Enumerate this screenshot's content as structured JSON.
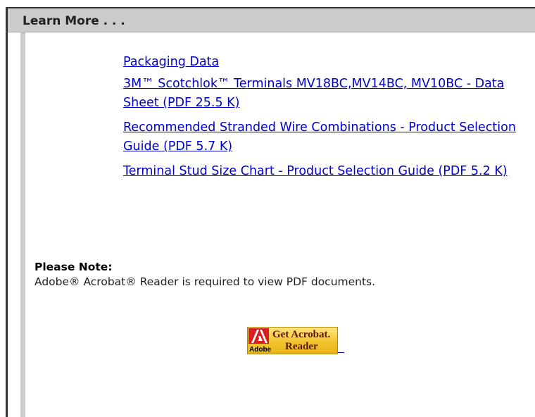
{
  "header": {
    "title": "Learn More . . ."
  },
  "links": [
    {
      "label": "Packaging Data"
    },
    {
      "label": "3M™ Scotchlok™ Terminals MV18BC,MV14BC, MV10BC - Data Sheet (PDF 25.5 K)"
    },
    {
      "label": "Recommended Stranded Wire Combinations - Product Selection Guide (PDF 5.7 K)"
    },
    {
      "label": "Terminal Stud Size Chart - Product Selection Guide (PDF 5.2 K)"
    }
  ],
  "note": {
    "title": "Please Note:",
    "text": "Adobe® Acrobat® Reader is required to view PDF documents."
  },
  "acrobat_badge": {
    "logo_text": "Adobe",
    "line1": "Get Acrobat.",
    "line2": "Reader"
  },
  "colors": {
    "header_bg": "#cccccc",
    "link": "#0000cc",
    "badge_yellow": "#f4c430",
    "adobe_red": "#d81e1e"
  }
}
